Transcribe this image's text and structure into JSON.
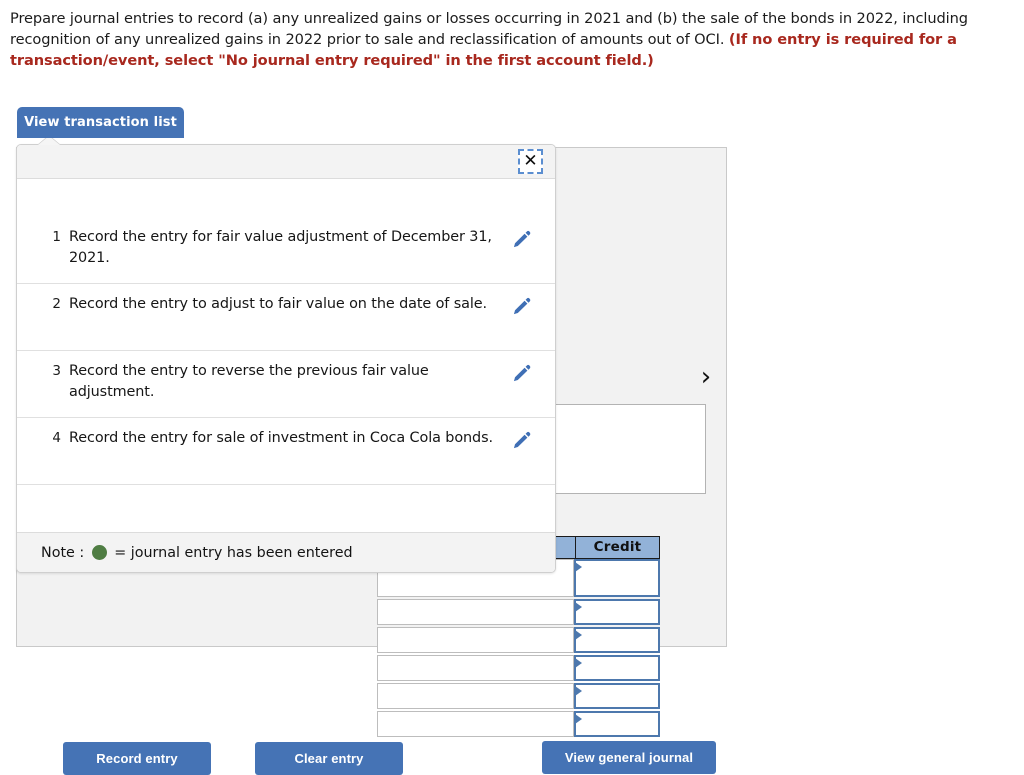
{
  "prompt": {
    "body_part1": "Prepare journal entries to record (a) any unrealized gains or losses occurring in 2021 and (b) the sale of the bonds in 2022, including recognition of any unrealized gains in 2022 prior to sale and reclassification of amounts out of OCI. ",
    "hint": "(If no entry is required for a transaction/event, select \"No journal entry required\" in the first account field.)"
  },
  "tab": {
    "label": "View transaction list"
  },
  "popup": {
    "close_label": "✕",
    "note_prefix": "Note :",
    "note_suffix": "= journal entry has been entered",
    "transactions": [
      {
        "num": "1",
        "text": "Record the entry for fair value adjustment of December 31, 2021."
      },
      {
        "num": "2",
        "text": "Record the entry to adjust to fair value on the date of sale."
      },
      {
        "num": "3",
        "text": "Record the entry to reverse the previous fair value adjustment."
      },
      {
        "num": "4",
        "text": "Record the entry for sale of investment in Coca Cola bonds."
      }
    ]
  },
  "journal": {
    "credit_header": "Credit",
    "row_count": 6
  },
  "panel": {
    "next_chevron": "›"
  },
  "buttons": {
    "record_entry": "Record entry",
    "clear_entry": "Clear entry",
    "view_general_journal": "View general journal"
  },
  "colors": {
    "accent_blue": "#4573b5",
    "table_header_blue": "#92b2d8",
    "cell_border_blue": "#4d78ad",
    "note_green": "#4f7d43",
    "hint_red": "#a8281e"
  }
}
